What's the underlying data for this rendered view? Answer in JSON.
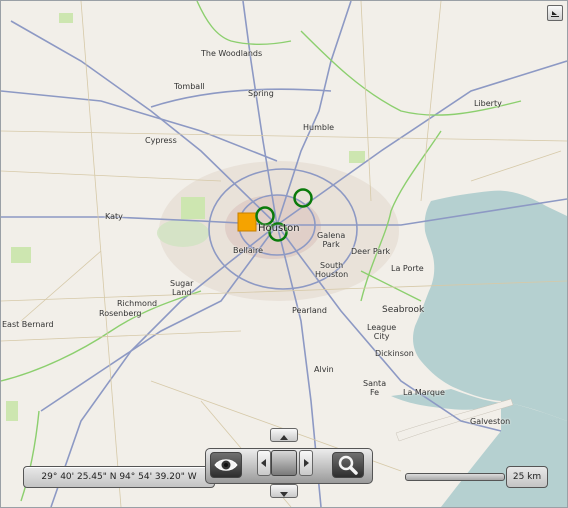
{
  "map": {
    "places": {
      "the_woodlands": "The Woodlands",
      "tomball": "Tomball",
      "spring": "Spring",
      "humble": "Humble",
      "liberty": "Liberty",
      "cypress": "Cypress",
      "katy": "Katy",
      "houston": "Houston",
      "bellaire": "Bellaire",
      "galena_park": "Galena\nPark",
      "deer_park": "Deer Park",
      "south_houston": "South\nHouston",
      "la_porte": "La Porte",
      "sugar_land": "Sugar\nLand",
      "richmond": "Richmond",
      "rosenberg": "Rosenberg",
      "east_bernard": "East Bernard",
      "pearland": "Pearland",
      "seabrook": "Seabrook",
      "league_city": "League\nCity",
      "dickinson": "Dickinson",
      "alvin": "Alvin",
      "santa_fe": "Santa\nFe",
      "la_marque": "La Marque",
      "galveston": "Galveston"
    },
    "marker_color": "#f5a300",
    "circle_color": "#0a7a0a",
    "water_color": "#b5d0d0",
    "highway_color": "#8d99c4",
    "secondary_color": "#8ccf6e"
  },
  "controls": {
    "coordinates": "29° 40' 25.45\" N 94° 54' 39.20\" W",
    "scale_label": "25 km",
    "corner_icon": "minimize-map-icon",
    "view_icon": "eye-icon",
    "zoom_icon": "magnifier-icon"
  }
}
